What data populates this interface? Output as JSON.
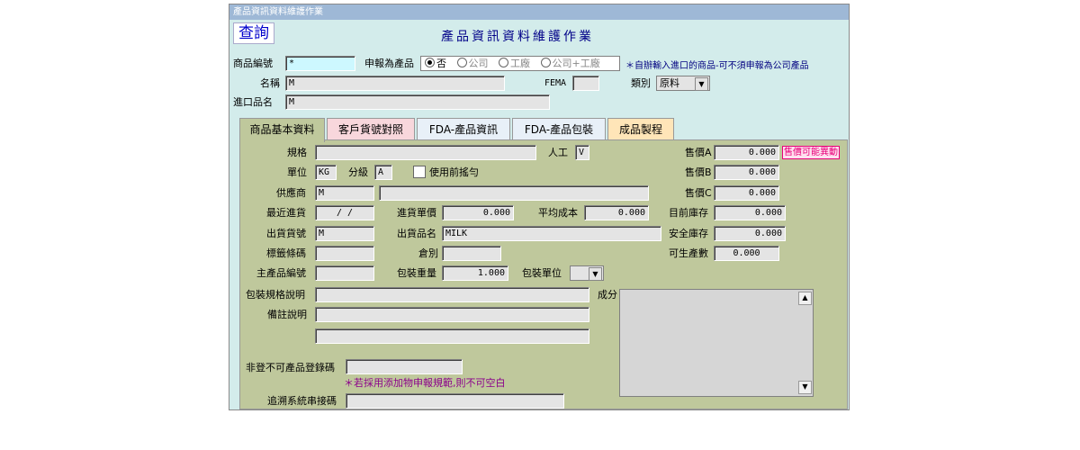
{
  "window": {
    "title": "產品資訊資料維護作業"
  },
  "header": {
    "query_button": "查詢",
    "form_title": "產品資訊資料維護作業"
  },
  "top": {
    "item_no_label": "商品編號",
    "item_no_value": "*",
    "declare_label": "申報為產品",
    "declare_options": [
      "否",
      "公司",
      "工廠",
      "公司+工廠"
    ],
    "note": "＊自辦輸入進口的商品-可不須申報為公司產品",
    "name_label": "名稱",
    "name_value": "M",
    "fema_label": "FEMA",
    "fema_value": "",
    "category_label": "類別",
    "category_value": "原料",
    "import_name_label": "進口品名",
    "import_name_value": "M"
  },
  "tabs": [
    {
      "label": "商品基本資料",
      "color": "#bfc89c"
    },
    {
      "label": "客戶貨號對照",
      "color": "#f8d7dc"
    },
    {
      "label": "FDA-產品資訊",
      "color": "#e8f0f8"
    },
    {
      "label": "FDA-產品包裝",
      "color": "#e8f0f8"
    },
    {
      "label": "成品製程",
      "color": "#ffe5b8"
    }
  ],
  "basic": {
    "spec_label": "規格",
    "spec_value": "",
    "manual_label": "人工",
    "manual_value": "V",
    "price_a_label": "售價A",
    "price_a_value": "0.000",
    "price_note": "售價可能異動",
    "unit_label": "單位",
    "unit_value": "KG",
    "grade_label": "分級",
    "grade_value": "A",
    "shake_label": "使用前搖勻",
    "price_b_label": "售價B",
    "price_b_value": "0.000",
    "supplier_label": "供應商",
    "supplier_code": "M",
    "supplier_name": "",
    "price_c_label": "售價C",
    "price_c_value": "0.000",
    "last_purchase_label": "最近進貨",
    "last_purchase_value": "/ /",
    "purchase_price_label": "進貨單價",
    "purchase_price_value": "0.000",
    "avg_cost_label": "平均成本",
    "avg_cost_value": "0.000",
    "stock_label": "目前庫存",
    "stock_value": "0.000",
    "ship_no_label": "出貨貨號",
    "ship_no_value": "M",
    "ship_name_label": "出貨品名",
    "ship_name_value": "MILK",
    "safety_stock_label": "安全庫存",
    "safety_stock_value": "0.000",
    "barcode_label": "標籤條碼",
    "barcode_value": "",
    "warehouse_label": "倉別",
    "warehouse_value": "",
    "producible_label": "可生產數",
    "producible_value": "0.000",
    "main_item_label": "主產品編號",
    "main_item_value": "",
    "pack_weight_label": "包裝重量",
    "pack_weight_value": "1.000",
    "pack_unit_label": "包裝單位",
    "pack_unit_value": "",
    "pack_spec_label": "包裝規格說明",
    "pack_spec_value": "",
    "ingredient_label": "成分",
    "remark_label": "備註說明",
    "remark_value1": "",
    "remark_value2": "",
    "nonreg_label": "非登不可產品登錄碼",
    "nonreg_value": "",
    "additive_warning": "＊若採用添加物申報規範,則不可空白",
    "trace_label": "追溯系統串接碼",
    "trace_value": ""
  }
}
